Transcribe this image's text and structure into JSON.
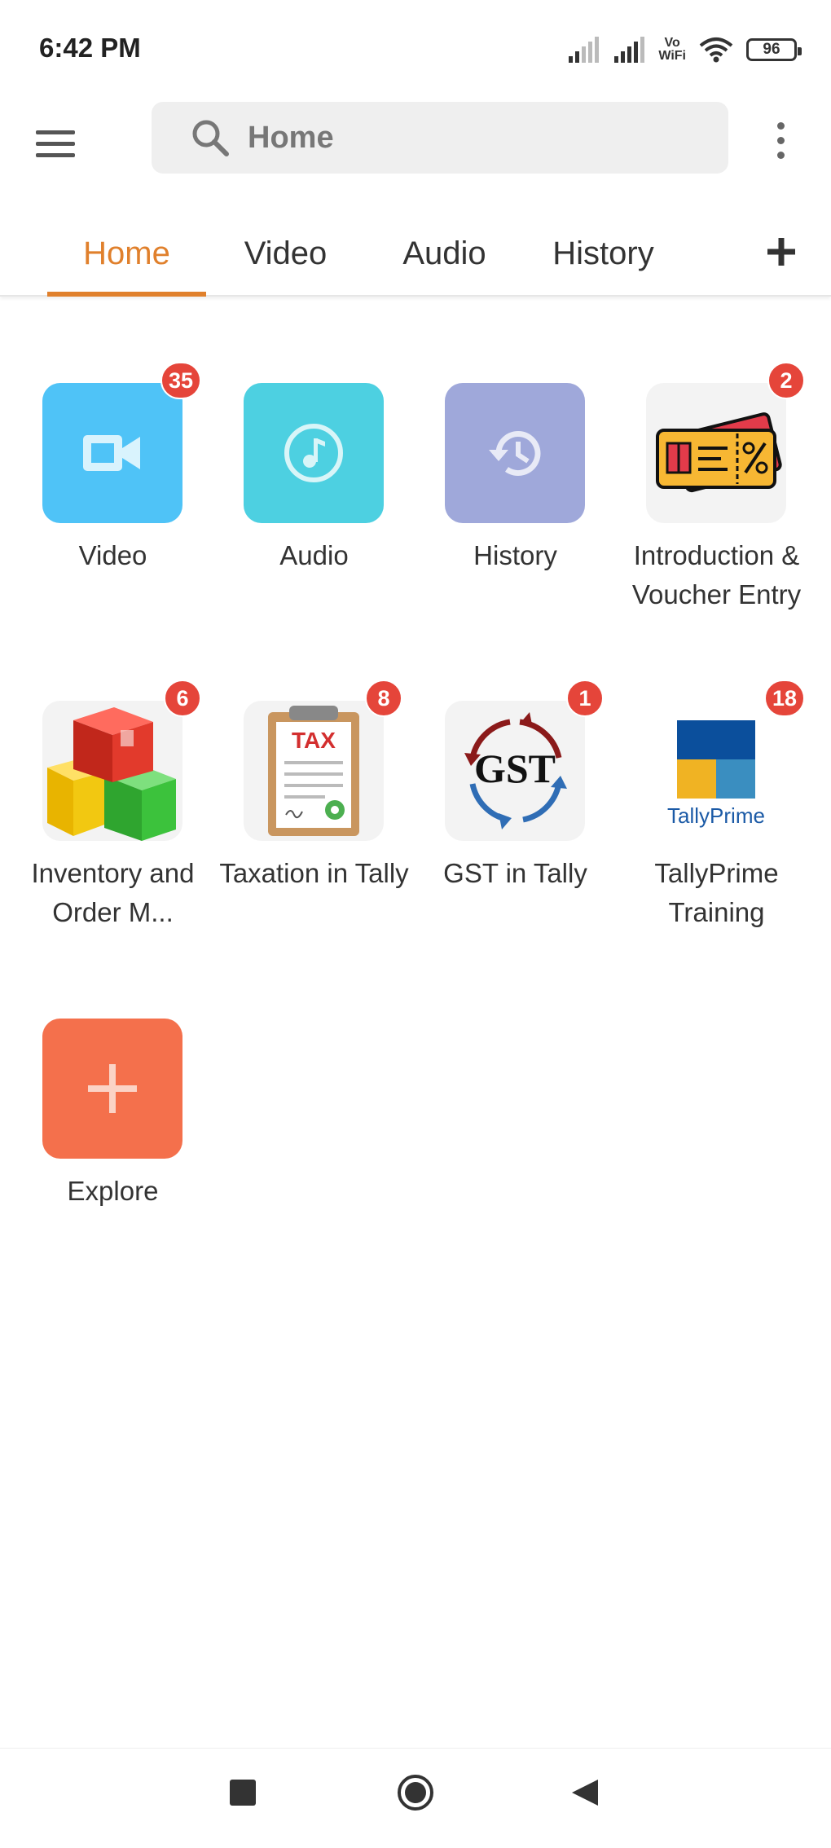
{
  "status_bar": {
    "time": "6:42 PM",
    "vowifi": "Vo\nWiFi",
    "battery": "96"
  },
  "app_bar": {
    "search_placeholder": "Home"
  },
  "tabs": [
    {
      "label": "Home",
      "active": true
    },
    {
      "label": "Video",
      "active": false
    },
    {
      "label": "Audio",
      "active": false
    },
    {
      "label": "History",
      "active": false
    }
  ],
  "grid": [
    {
      "label": "Video",
      "badge": "35",
      "icon": "video-camera-icon",
      "color": "#4fc3f7"
    },
    {
      "label": "Audio",
      "badge": "",
      "icon": "music-note-icon",
      "color": "#4dd0e1"
    },
    {
      "label": "History",
      "badge": "",
      "icon": "history-clock-icon",
      "color": "#9fa8da"
    },
    {
      "label": "Introduction & Voucher Entry",
      "badge": "2",
      "icon": "voucher-ticket-icon"
    },
    {
      "label": "Inventory and Order M...",
      "badge": "6",
      "icon": "inventory-boxes-icon"
    },
    {
      "label": "Taxation in Tally",
      "badge": "8",
      "icon": "tax-clipboard-icon"
    },
    {
      "label": "GST in Tally",
      "badge": "1",
      "icon": "gst-cycle-icon",
      "logo_text": "GST"
    },
    {
      "label": "TallyPrime Training",
      "badge": "18",
      "icon": "tallyprime-logo-icon",
      "logo_text": "TallyPrime"
    },
    {
      "label": "Explore",
      "badge": "",
      "icon": "plus-icon",
      "color": "#f4704c"
    }
  ],
  "colors": {
    "accent": "#e0802c",
    "badge": "#e5453a"
  }
}
